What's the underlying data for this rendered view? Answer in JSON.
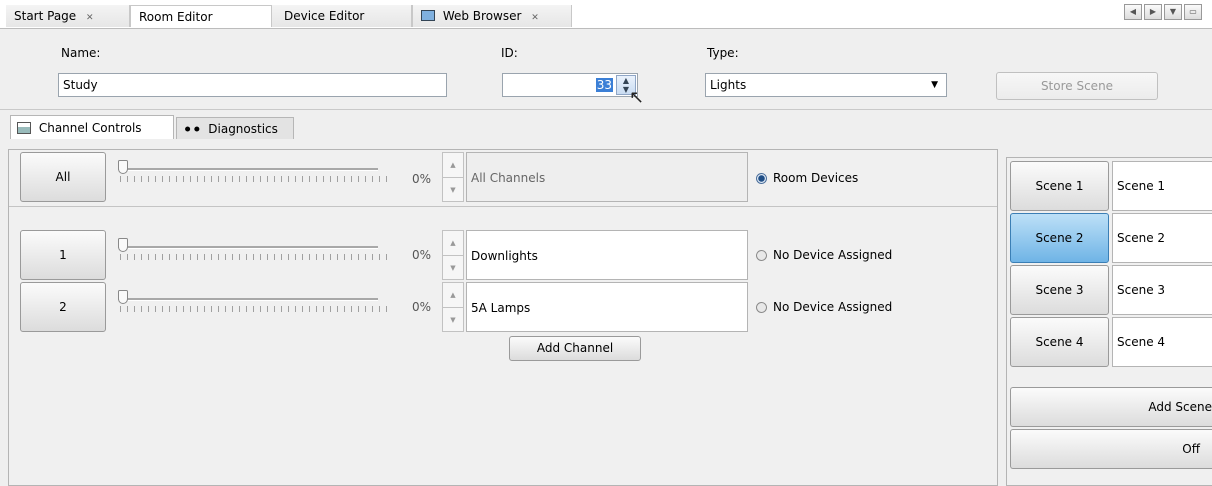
{
  "tabs": [
    {
      "label": "Start Page",
      "closable": true
    },
    {
      "label": "Room Editor",
      "closable": false
    },
    {
      "label": "Device Editor",
      "closable": false
    },
    {
      "label": "Web Browser",
      "closable": true
    }
  ],
  "form": {
    "name_label": "Name:",
    "name_value": "Study",
    "id_label": "ID:",
    "id_value": "33",
    "type_label": "Type:",
    "type_value": "Lights",
    "store_scene_label": "Store Scene"
  },
  "subtabs": {
    "channel_controls": "Channel Controls",
    "diagnostics": "Diagnostics"
  },
  "all_row": {
    "button": "All",
    "percent": "0%",
    "name": "All Channels",
    "radio": "Room Devices"
  },
  "channels": [
    {
      "button": "1",
      "percent": "0%",
      "name": "Downlights",
      "radio": "No Device Assigned"
    },
    {
      "button": "2",
      "percent": "0%",
      "name": "5A Lamps",
      "radio": "No Device Assigned"
    }
  ],
  "add_channel_label": "Add Channel",
  "scenes": [
    {
      "button": "Scene 1",
      "name": "Scene 1"
    },
    {
      "button": "Scene 2",
      "name": "Scene 2"
    },
    {
      "button": "Scene 3",
      "name": "Scene 3"
    },
    {
      "button": "Scene 4",
      "name": "Scene 4"
    }
  ],
  "add_scene_label": "Add Scene",
  "off_label": "Off",
  "icons": {
    "close": "close-icon",
    "web_browser": "monitor-icon",
    "channel_controls": "console-icon",
    "diagnostics": "binoculars-icon"
  }
}
